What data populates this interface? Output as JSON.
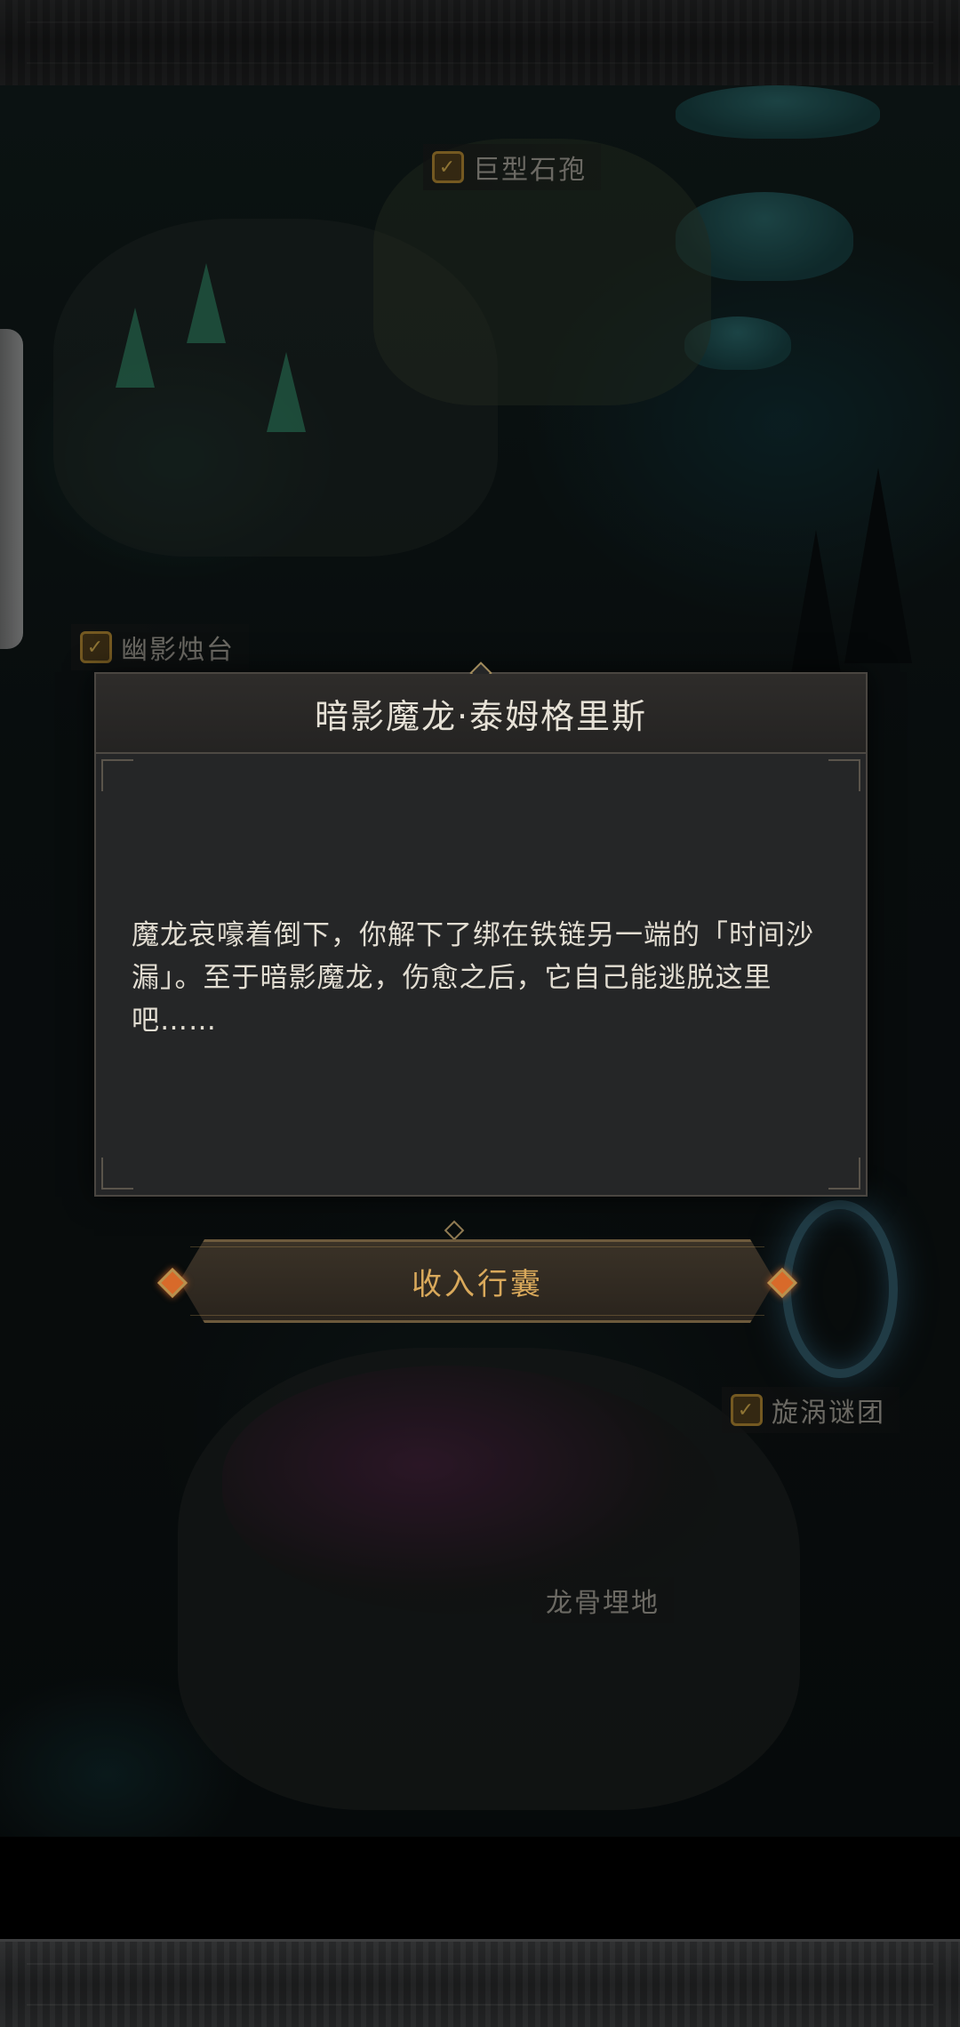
{
  "locations": {
    "giant_spore": {
      "label": "巨型石孢",
      "visited": true
    },
    "shadow_candle": {
      "label": "幽影烛台",
      "visited": true
    },
    "vortex": {
      "label": "旋涡谜团",
      "visited": true
    },
    "dragon_bone": {
      "label": "龙骨埋地",
      "visited": false
    }
  },
  "dialog": {
    "title": "暗影魔龙·泰姆格里斯",
    "body": "魔龙哀嚎着倒下，你解下了绑在铁链另一端的「时间沙漏」。至于暗影魔龙，伤愈之后，它自己能逃脱这里吧……",
    "button_label": "收入行囊"
  },
  "icons": {
    "check": "✓"
  },
  "colors": {
    "accent_gold": "#d9a95b",
    "gem_orange": "#d86a2a",
    "check_gold": "#c89a3a"
  }
}
